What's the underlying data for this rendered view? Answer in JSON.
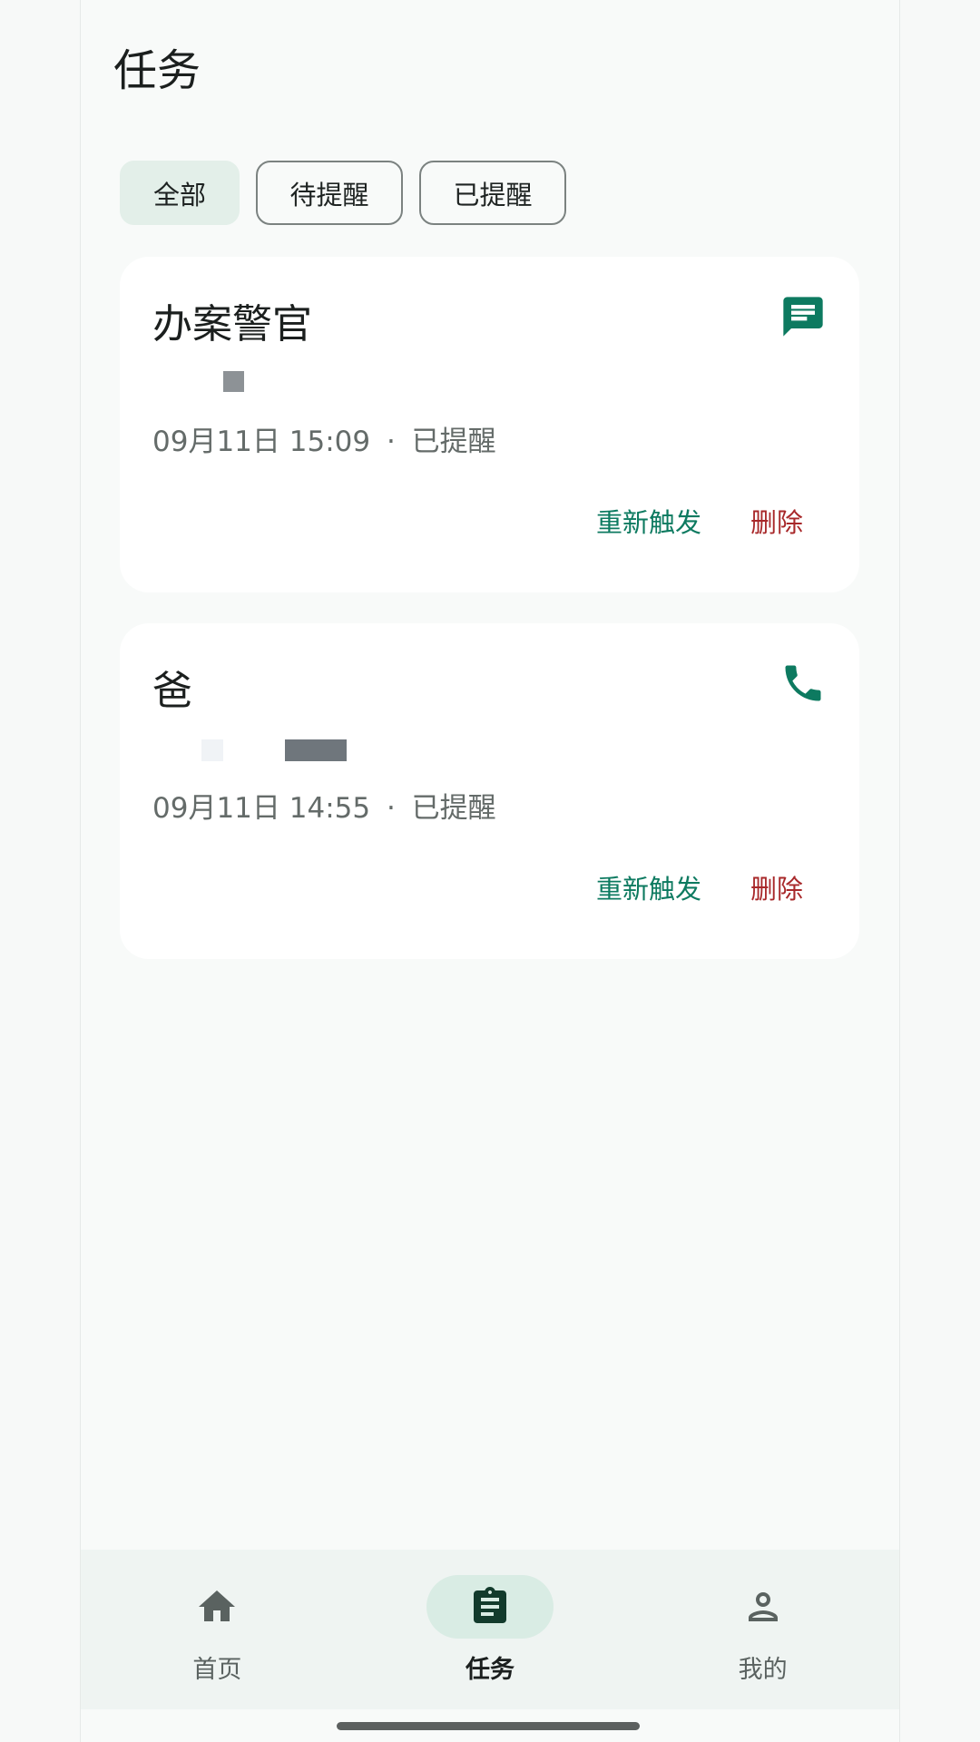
{
  "header": {
    "title": "任务"
  },
  "filters": {
    "all": "全部",
    "pending": "待提醒",
    "done": "已提醒"
  },
  "tasks": [
    {
      "name": "办案警官",
      "icon": "message-icon",
      "time": "09月11日 15:09",
      "separator": "·",
      "status": "已提醒",
      "retrigger": "重新触发",
      "delete": "删除"
    },
    {
      "name": "爸",
      "icon": "phone-icon",
      "time": "09月11日 14:55",
      "separator": "·",
      "status": "已提醒",
      "retrigger": "重新触发",
      "delete": "删除"
    }
  ],
  "nav": {
    "home": "首页",
    "tasks": "任务",
    "mine": "我的"
  },
  "colors": {
    "accent": "#0d7a60",
    "danger": "#a8282a",
    "chip_active": "#e3efe9",
    "nav_pill": "#d9ece4"
  }
}
